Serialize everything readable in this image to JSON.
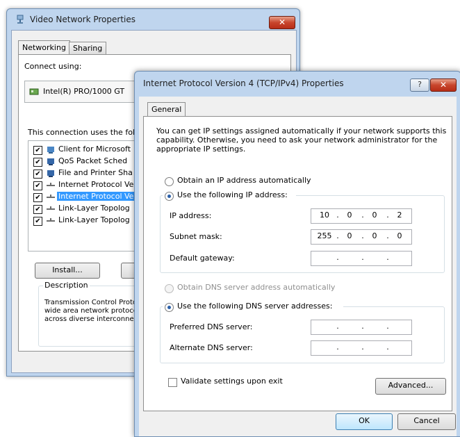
{
  "back_window": {
    "title": "Video Network Properties",
    "close_label": "✕",
    "tabs": [
      "Networking",
      "Sharing"
    ],
    "connect_using_label": "Connect using:",
    "device_name": "Intel(R) PRO/1000 GT",
    "connection_uses_label": "This connection uses the fol",
    "items": [
      {
        "label": "Client for Microsoft",
        "checked": true
      },
      {
        "label": "QoS Packet Sched",
        "checked": true
      },
      {
        "label": "File and Printer Sha",
        "checked": true
      },
      {
        "label": "Internet Protocol Ve",
        "checked": true
      },
      {
        "label": "Internet Protocol Ve",
        "checked": true,
        "selected": true
      },
      {
        "label": "Link-Layer Topolog",
        "checked": true
      },
      {
        "label": "Link-Layer Topolog",
        "checked": true
      }
    ],
    "install_label": "Install...",
    "description_title": "Description",
    "description_lines": [
      "Transmission Control Proto",
      "wide area network protoco",
      "across diverse interconne"
    ]
  },
  "dialog": {
    "title": "Internet Protocol Version 4 (TCP/IPv4) Properties",
    "help_label": "?",
    "close_label": "✕",
    "tab_general": "General",
    "intro_text": "You can get IP settings assigned automatically if your network supports this capability. Otherwise, you need to ask your network administrator for the appropriate IP settings.",
    "obtain_ip_auto_label": "Obtain an IP address automatically",
    "use_following_ip_label": "Use the following IP address:",
    "ip_address_label": "IP address:",
    "ip_address": [
      "10",
      "0",
      "0",
      "2"
    ],
    "subnet_mask_label": "Subnet mask:",
    "subnet_mask": [
      "255",
      "0",
      "0",
      "0"
    ],
    "default_gateway_label": "Default gateway:",
    "default_gateway": [
      "",
      "",
      "",
      ""
    ],
    "obtain_dns_auto_label": "Obtain DNS server address automatically",
    "use_following_dns_label": "Use the following DNS server addresses:",
    "preferred_dns_label": "Preferred DNS server:",
    "preferred_dns": [
      "",
      "",
      "",
      ""
    ],
    "alternate_dns_label": "Alternate DNS server:",
    "alternate_dns": [
      "",
      "",
      "",
      ""
    ],
    "validate_label": "Validate settings upon exit",
    "validate_checked": false,
    "advanced_label": "Advanced...",
    "ok_label": "OK",
    "cancel_label": "Cancel",
    "ip_mode": "manual",
    "dns_mode": "manual"
  },
  "colors": {
    "selection": "#3399ff",
    "window_frame": "#bfd5ee",
    "close_button": "#c8452c"
  }
}
